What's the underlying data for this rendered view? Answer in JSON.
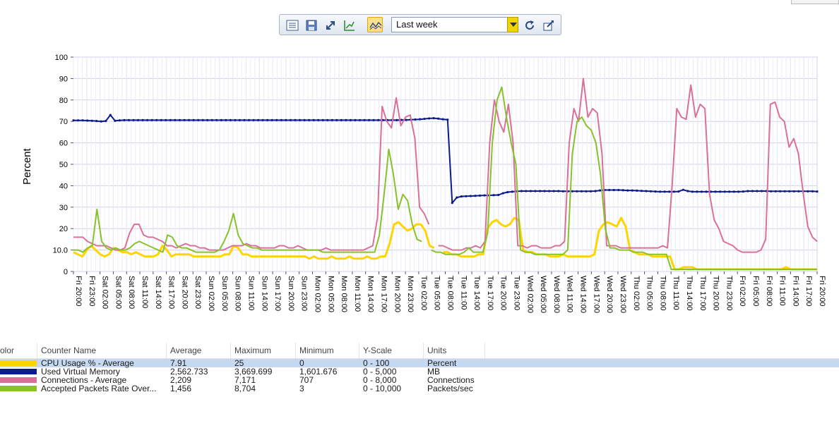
{
  "toolbar": {
    "buttons": [
      "list-icon",
      "save-icon",
      "expand-icon",
      "chart-scale-icon",
      "line-chart-icon"
    ],
    "time_range": "Last week",
    "refresh_icon": "refresh-icon",
    "export_icon": "edit-export-icon"
  },
  "chart_data": {
    "type": "line",
    "ylabel": "Percent",
    "ylim": [
      0,
      100
    ],
    "yticks": [
      "0",
      "10.0",
      "20",
      "30",
      "40",
      "50",
      "60",
      "70",
      "80",
      "90",
      "100"
    ],
    "xticks": [
      "Fri 20:00",
      "Fri 23:00",
      "Sat 02:00",
      "Sat 05:00",
      "Sat 08:00",
      "Sat 11:00",
      "Sat 14:00",
      "Sat 17:00",
      "Sat 20:00",
      "Sat 23:00",
      "Sun 02:00",
      "Sun 05:00",
      "Sun 08:00",
      "Sun 11:00",
      "Sun 14:00",
      "Sun 17:00",
      "Sun 20:00",
      "Sun 23:00",
      "Mon 02:00",
      "Mon 05:00",
      "Mon 08:00",
      "Mon 11:00",
      "Mon 14:00",
      "Mon 17:00",
      "Mon 20:00",
      "Mon 23:00",
      "Tue 02:00",
      "Tue 05:00",
      "Tue 08:00",
      "Tue 11:00",
      "Tue 14:00",
      "Tue 17:00",
      "Tue 20:00",
      "Tue 23:00",
      "Wed 02:00",
      "Wed 05:00",
      "Wed 08:00",
      "Wed 11:00",
      "Wed 14:00",
      "Wed 17:00",
      "Wed 20:00",
      "Wed 23:00",
      "Thu 02:00",
      "Thu 05:00",
      "Thu 08:00",
      "Thu 11:00",
      "Thu 14:00",
      "Thu 17:00",
      "Thu 20:00",
      "Thu 23:00",
      "Fri 02:00",
      "Fri 05:00",
      "Fri 08:00",
      "Fri 11:00",
      "Fri 14:00",
      "Fri 17:00",
      "Fri 20:00"
    ],
    "grid": true,
    "series": [
      {
        "name": "CPU Usage % - Average",
        "color": "#ffd400",
        "width": 3,
        "values": [
          9,
          8,
          7,
          10,
          12,
          10,
          8,
          7,
          8,
          11,
          10,
          9,
          9,
          8,
          9,
          8,
          7,
          7,
          7,
          8,
          12,
          10,
          7,
          8,
          8,
          8,
          8,
          7,
          7,
          7,
          7,
          7,
          7,
          7,
          8,
          8,
          12,
          11,
          8,
          8,
          7,
          7,
          7,
          7,
          7,
          7,
          7,
          7,
          7,
          7,
          7,
          7,
          7,
          6,
          7,
          6,
          6,
          6,
          7,
          6,
          6,
          6,
          7,
          6,
          6,
          6,
          7,
          6,
          6,
          7,
          7,
          13,
          22,
          23,
          21,
          19,
          20,
          22,
          22,
          19,
          12,
          11,
          null,
          9,
          9,
          8,
          8,
          7,
          7,
          7,
          7,
          8,
          8,
          20,
          23,
          24,
          22,
          21,
          22,
          25,
          24,
          10,
          9,
          9,
          8,
          8,
          8,
          7,
          7,
          7,
          8,
          7,
          7,
          7,
          7,
          7,
          7,
          8,
          19,
          22,
          23,
          22,
          21,
          25,
          21,
          10,
          9,
          8,
          8,
          8,
          7,
          7,
          7,
          7,
          7,
          1,
          1,
          2,
          2,
          2,
          1,
          1,
          1,
          1,
          1,
          1,
          1,
          1,
          1,
          1,
          1,
          1,
          1,
          1,
          1,
          1,
          1,
          1,
          1,
          1,
          2,
          1,
          1,
          1,
          1,
          1,
          1,
          1
        ]
      },
      {
        "name": "Used Virtual Memory",
        "color": "#0b1a8c",
        "width": 2,
        "values": [
          70.5,
          70.5,
          70.5,
          70.4,
          70.3,
          70.2,
          70.0,
          70.2,
          73.0,
          70.3,
          70.5,
          70.6,
          70.6,
          70.6,
          70.6,
          70.6,
          70.6,
          70.6,
          70.6,
          70.6,
          70.6,
          70.6,
          70.6,
          70.6,
          70.6,
          70.6,
          70.6,
          70.6,
          70.6,
          70.6,
          70.6,
          70.6,
          70.6,
          70.6,
          70.6,
          70.6,
          70.6,
          70.6,
          70.6,
          70.6,
          70.6,
          70.6,
          70.6,
          70.6,
          70.6,
          70.6,
          70.6,
          70.6,
          70.6,
          70.6,
          70.6,
          70.6,
          70.6,
          70.6,
          70.6,
          70.6,
          70.6,
          70.6,
          70.6,
          70.6,
          70.6,
          70.6,
          70.6,
          70.6,
          70.6,
          70.6,
          70.6,
          70.6,
          70.6,
          70.6,
          70.6,
          70.7,
          70.7,
          70.8,
          70.9,
          71.0,
          71.2,
          71.4,
          71.5,
          71.3,
          71.0,
          70.8,
          32.0,
          34.5,
          35.0,
          35.1,
          35.2,
          35.3,
          35.4,
          35.5,
          35.5,
          35.6,
          35.7,
          36.5,
          37.0,
          37.2,
          37.4,
          37.5,
          37.5,
          37.5,
          37.5,
          37.5,
          37.5,
          37.5,
          37.5,
          37.5,
          37.4,
          37.4,
          37.4,
          37.4,
          37.4,
          37.4,
          37.4,
          37.5,
          37.8,
          38.0,
          38.0,
          38.0,
          38.0,
          37.9,
          37.8,
          37.8,
          37.7,
          37.6,
          37.5,
          37.4,
          37.3,
          37.2,
          37.2,
          37.2,
          37.2,
          37.3,
          38.1,
          37.5,
          37.2,
          37.2,
          37.2,
          37.2,
          37.2,
          37.2,
          37.2,
          37.2,
          37.2,
          37.2,
          37.2,
          37.3,
          37.5,
          37.5,
          37.5,
          37.5,
          37.5,
          37.4,
          37.4,
          37.4,
          37.4,
          37.4,
          37.4,
          37.4,
          37.4,
          37.4,
          37.4,
          37.3
        ]
      },
      {
        "name": "Connections - Average",
        "color": "#d9709a",
        "width": 2,
        "values": [
          16,
          16,
          16,
          14,
          13,
          12,
          12,
          12,
          11,
          10,
          10,
          11,
          18,
          22,
          22,
          17,
          16,
          16,
          15,
          14,
          12,
          12,
          11,
          12,
          13,
          12,
          12,
          11,
          11,
          10,
          10,
          10,
          10,
          11,
          12,
          12,
          12,
          13,
          12,
          12,
          11,
          11,
          11,
          11,
          12,
          12,
          11,
          11,
          12,
          11,
          10,
          10,
          10,
          10,
          11,
          10,
          10,
          10,
          10,
          10,
          10,
          10,
          10,
          11,
          12,
          25,
          77,
          70,
          67,
          81,
          68,
          72,
          73,
          62,
          30,
          27,
          22,
          null,
          12,
          12,
          11,
          10,
          10,
          10,
          11,
          11,
          12,
          11,
          14,
          60,
          80,
          70,
          65,
          78,
          60,
          12,
          12,
          11,
          12,
          12,
          11,
          11,
          11,
          12,
          12,
          14,
          60,
          76,
          70,
          90,
          72,
          76,
          74,
          55,
          12,
          12,
          12,
          11,
          11,
          11,
          11,
          11,
          11,
          11,
          11,
          11,
          12,
          11,
          40,
          76,
          72,
          71,
          87,
          72,
          78,
          76,
          36,
          24,
          20,
          14,
          13,
          12,
          10,
          9,
          9,
          9,
          9,
          10,
          15,
          78,
          79,
          72,
          70,
          58,
          62,
          55,
          37,
          21,
          16,
          14
        ]
      },
      {
        "name": "Accepted Packets Rate Over...",
        "color": "#88c22a",
        "width": 2,
        "values": [
          10,
          10,
          9,
          11,
          12,
          29,
          14,
          11,
          10,
          11,
          10,
          10,
          11,
          13,
          14,
          13,
          12,
          11,
          10,
          9,
          17,
          16,
          12,
          11,
          11,
          10,
          9,
          9,
          9,
          9,
          9,
          10,
          14,
          19,
          27,
          17,
          13,
          12,
          11,
          11,
          10,
          10,
          10,
          10,
          10,
          10,
          10,
          10,
          10,
          10,
          10,
          10,
          10,
          9,
          9,
          9,
          9,
          9,
          9,
          9,
          9,
          9,
          9,
          9,
          9,
          17,
          36,
          57,
          45,
          29,
          36,
          33,
          22,
          15,
          14,
          null,
          10,
          9,
          9,
          8,
          8,
          8,
          8,
          9,
          11,
          9,
          9,
          9,
          18,
          60,
          80,
          86,
          72,
          60,
          50,
          10,
          9,
          9,
          8,
          8,
          8,
          8,
          8,
          8,
          8,
          10,
          55,
          70,
          72,
          68,
          66,
          60,
          45,
          20,
          11,
          11,
          10,
          10,
          10,
          9,
          9,
          9,
          8,
          8,
          8,
          8,
          8,
          1,
          1,
          1,
          1,
          1,
          1,
          1,
          1,
          1,
          1,
          1,
          1,
          1,
          1,
          1,
          1,
          1,
          1,
          1,
          1,
          1,
          1,
          1,
          1,
          1,
          1,
          1,
          1,
          1,
          1,
          1,
          1
        ]
      }
    ]
  },
  "legend": {
    "headers": {
      "color": "olor",
      "name": "Counter Name",
      "average": "Average",
      "maximum": "Maximum",
      "minimum": "Minimum",
      "yscale": "Y-Scale",
      "units": "Units"
    },
    "rows": [
      {
        "color": "#ffd400",
        "name": "CPU Usage % - Average",
        "average": "7.91",
        "maximum": "25",
        "minimum": "0",
        "yscale": "0 - 100",
        "units": "Percent"
      },
      {
        "color": "#0b1a8c",
        "name": "Used Virtual Memory",
        "average": "2,562.733",
        "maximum": "3,669.699",
        "minimum": "1,601.676",
        "yscale": "0 - 5,000",
        "units": "MB"
      },
      {
        "color": "#d9709a",
        "name": "Connections - Average",
        "average": "2,209",
        "maximum": "7,171",
        "minimum": "707",
        "yscale": "0 - 8,000",
        "units": "Connections"
      },
      {
        "color": "#88c22a",
        "name": "Accepted Packets Rate Over...",
        "average": "1,456",
        "maximum": "8,704",
        "minimum": "3",
        "yscale": "0 - 10,000",
        "units": "Packets/sec"
      }
    ]
  }
}
